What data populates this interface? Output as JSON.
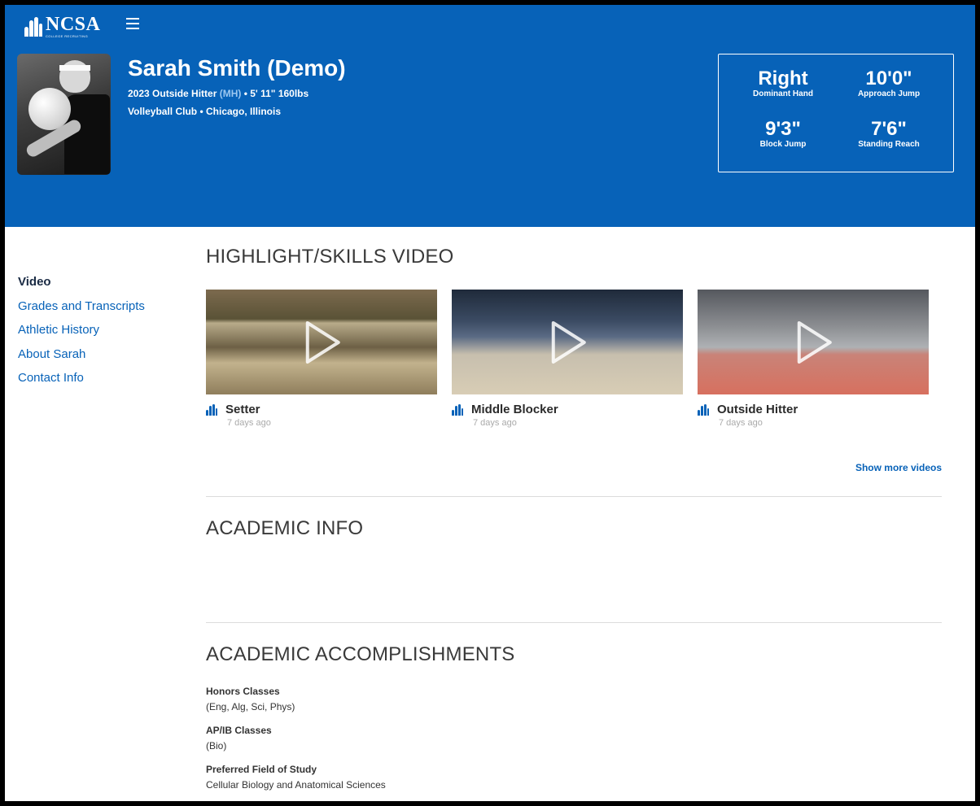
{
  "header": {
    "logo_text": "NCSA",
    "logo_subtext": "COLLEGE RECRUITING",
    "athlete_name": "Sarah Smith (Demo)",
    "subline_prefix": "2023 Outside Hitter",
    "subline_position": "(MH)",
    "subline_suffix": "• 5' 11\" 160lbs",
    "club_location": "Volleyball Club • Chicago, Illinois",
    "stats": [
      {
        "value": "Right",
        "label": "Dominant Hand"
      },
      {
        "value": "10'0\"",
        "label": "Approach Jump"
      },
      {
        "value": "9'3\"",
        "label": "Block Jump"
      },
      {
        "value": "7'6\"",
        "label": "Standing Reach"
      }
    ]
  },
  "sidebar": {
    "items": [
      {
        "label": "Video"
      },
      {
        "label": "Grades and Transcripts"
      },
      {
        "label": "Athletic History"
      },
      {
        "label": "About Sarah"
      },
      {
        "label": "Contact Info"
      }
    ]
  },
  "videos_section": {
    "title": "HIGHLIGHT/SKILLS VIDEO",
    "videos": [
      {
        "title": "Setter",
        "date": "7 days ago"
      },
      {
        "title": "Middle Blocker",
        "date": "7 days ago"
      },
      {
        "title": "Outside Hitter",
        "date": "7 days ago"
      }
    ],
    "show_more": "Show more videos"
  },
  "academic_info": {
    "title": "ACADEMIC INFO"
  },
  "academic_accomplishments": {
    "title": "ACADEMIC ACCOMPLISHMENTS",
    "items": [
      {
        "label": "Honors Classes",
        "value": "(Eng, Alg, Sci, Phys)"
      },
      {
        "label": "AP/IB Classes",
        "value": "(Bio)"
      },
      {
        "label": "Preferred Field of Study",
        "value": "Cellular Biology and Anatomical Sciences"
      }
    ]
  },
  "colors": {
    "brand_blue": "#0762b8",
    "text_dark": "#3a3a3a"
  }
}
